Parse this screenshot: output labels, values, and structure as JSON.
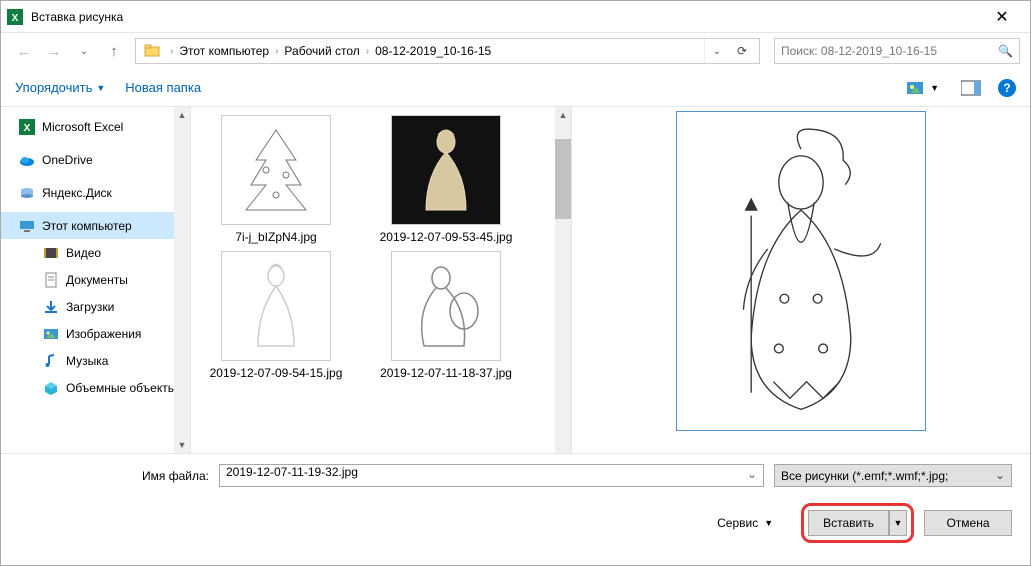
{
  "window": {
    "title": "Вставка рисунка"
  },
  "breadcrumb": {
    "root": "Этот компьютер",
    "mid": "Рабочий стол",
    "leaf": "08-12-2019_10-16-15"
  },
  "search": {
    "placeholder": "Поиск: 08-12-2019_10-16-15"
  },
  "toolbar": {
    "organize": "Упорядочить",
    "new_folder": "Новая папка"
  },
  "sidebar": {
    "items": [
      {
        "label": "Microsoft Excel",
        "icon": "excel"
      },
      {
        "label": "OneDrive",
        "icon": "onedrive"
      },
      {
        "label": "Яндекс.Диск",
        "icon": "yadisk"
      },
      {
        "label": "Этот компьютер",
        "icon": "pc",
        "selected": true
      },
      {
        "label": "Видео",
        "icon": "video",
        "indent": true
      },
      {
        "label": "Документы",
        "icon": "docs",
        "indent": true
      },
      {
        "label": "Загрузки",
        "icon": "downloads",
        "indent": true
      },
      {
        "label": "Изображения",
        "icon": "images",
        "indent": true
      },
      {
        "label": "Музыка",
        "icon": "music",
        "indent": true
      },
      {
        "label": "Объемные объекты",
        "icon": "3d",
        "indent": true
      }
    ]
  },
  "files": [
    {
      "name": "7i-j_bIZpN4.jpg",
      "dark": false,
      "motif": "tree"
    },
    {
      "name": "2019-12-07-09-53-45.jpg",
      "dark": true,
      "motif": "maiden"
    },
    {
      "name": "2019-12-07-09-54-15.jpg",
      "dark": false,
      "motif": "maiden-outline"
    },
    {
      "name": "2019-12-07-11-18-37.jpg",
      "dark": false,
      "motif": "person-outline"
    }
  ],
  "footer": {
    "filename_label": "Имя файла:",
    "filename_value": "2019-12-07-11-19-32.jpg",
    "filetype": "Все рисунки (*.emf;*.wmf;*.jpg;",
    "service": "Сервис",
    "insert": "Вставить",
    "cancel": "Отмена"
  }
}
